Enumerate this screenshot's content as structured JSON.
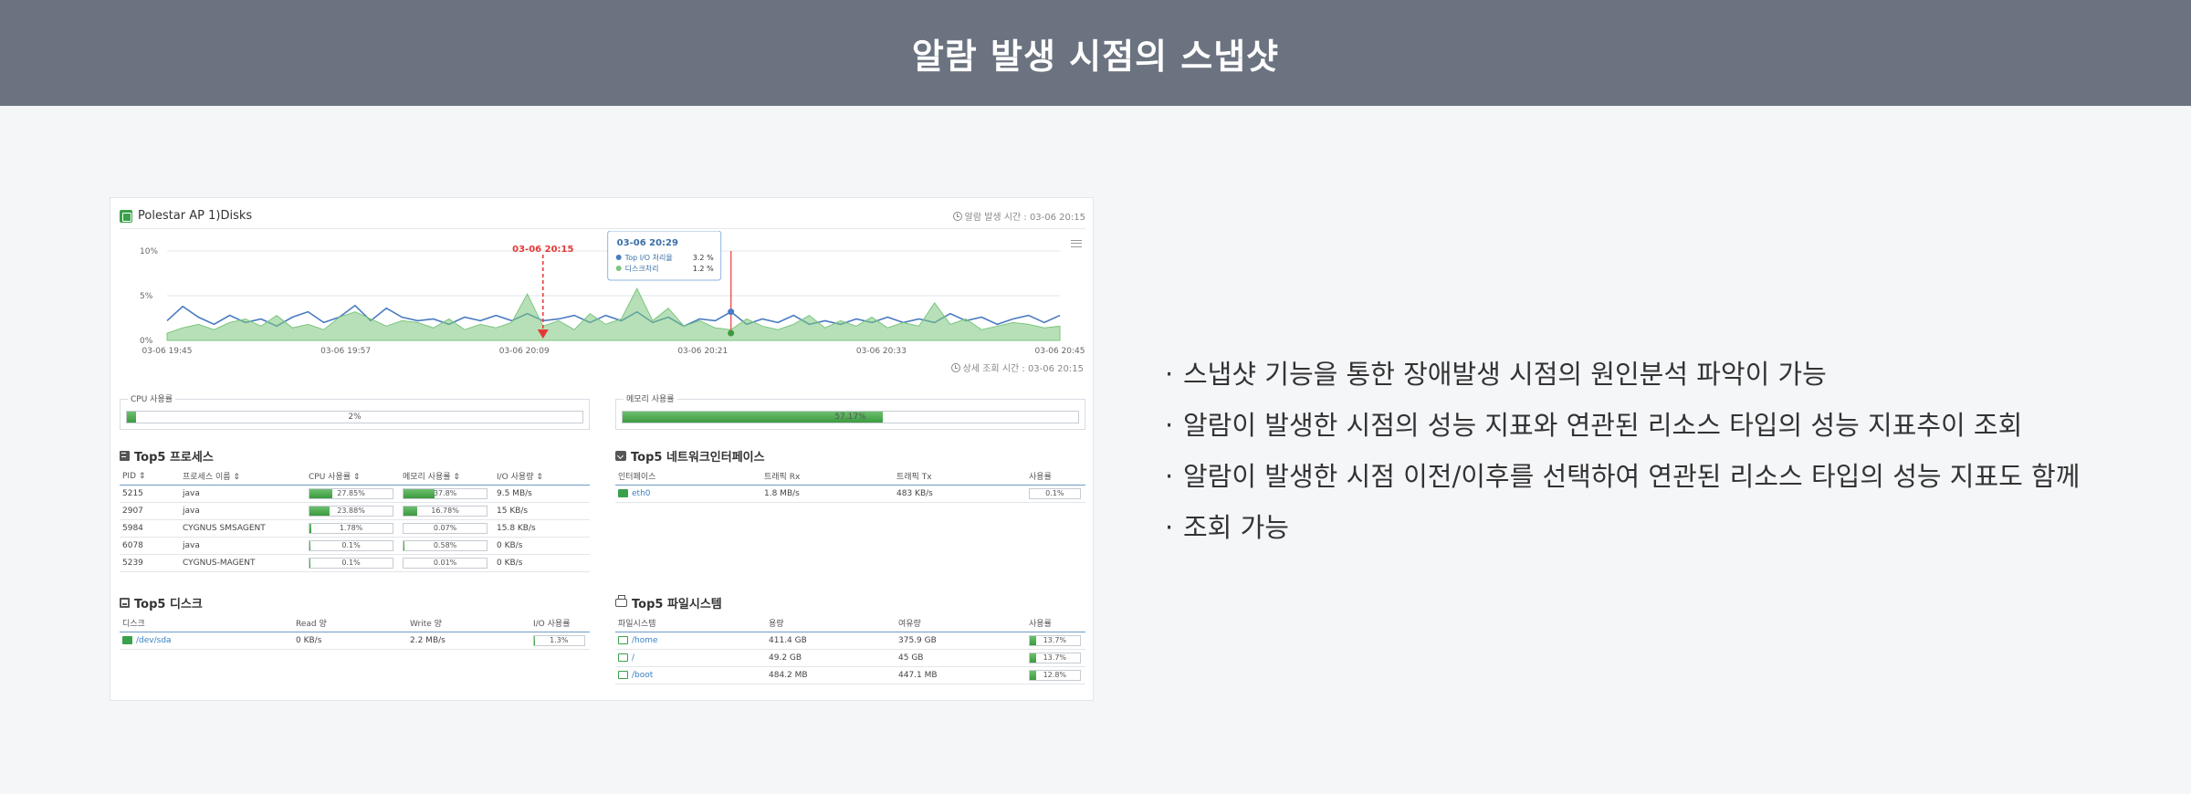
{
  "banner": {
    "title": "알람 발생 시점의 스냅샷"
  },
  "snapshot": {
    "title": "Polestar AP 1)Disks",
    "alarm_time_label": "알람 발생 시간 : 03-06 20:15",
    "query_time_label": "상세 조회 시간 : 03-06 20:15",
    "cpu_panel": {
      "label": "CPU 사용률",
      "value_label": "2%",
      "percent": 2
    },
    "mem_panel": {
      "label": "메모리 사용률",
      "value_label": "57.17%",
      "percent": 57.17
    },
    "top5_process": {
      "title": "Top5 프로세스",
      "columns": [
        "PID ⇕",
        "프로세스 이름 ⇕",
        "CPU 사용률 ⇕",
        "메모리 사용률 ⇕",
        "I/O 사용량 ⇕"
      ],
      "rows": [
        {
          "pid": "5215",
          "name": "java",
          "cpu": "27.85%",
          "cpu_pct": 27.85,
          "mem": "37.8%",
          "mem_pct": 37.8,
          "io": "9.5 MB/s"
        },
        {
          "pid": "2907",
          "name": "java",
          "cpu": "23.88%",
          "cpu_pct": 23.88,
          "mem": "16.78%",
          "mem_pct": 16.78,
          "io": "15 KB/s"
        },
        {
          "pid": "5984",
          "name": "CYGNUS SMSAGENT",
          "cpu": "1.78%",
          "cpu_pct": 1.78,
          "mem": "0.07%",
          "mem_pct": 0.07,
          "io": "15.8 KB/s"
        },
        {
          "pid": "6078",
          "name": "java",
          "cpu": "0.1%",
          "cpu_pct": 0.1,
          "mem": "0.58%",
          "mem_pct": 0.58,
          "io": "0 KB/s"
        },
        {
          "pid": "5239",
          "name": "CYGNUS-MAGENT",
          "cpu": "0.1%",
          "cpu_pct": 0.1,
          "mem": "0.01%",
          "mem_pct": 0.01,
          "io": "0 KB/s"
        }
      ]
    },
    "top5_network": {
      "title": "Top5 네트워크인터페이스",
      "columns": [
        "인터페이스",
        "트래픽 Rx",
        "트래픽 Tx",
        "사용률"
      ],
      "rows": [
        {
          "name": "eth0",
          "rx": "1.8 MB/s",
          "tx": "483 KB/s",
          "usage": "0.1%",
          "usage_pct": 0.1
        }
      ]
    },
    "top5_disk": {
      "title": "Top5 디스크",
      "columns": [
        "디스크",
        "Read 양",
        "Write 양",
        "I/O 사용률"
      ],
      "rows": [
        {
          "name": "/dev/sda",
          "read": "0 KB/s",
          "write": "2.2 MB/s",
          "usage": "1.3%",
          "usage_pct": 1.3
        }
      ]
    },
    "top5_fs": {
      "title": "Top5 파일시스템",
      "columns": [
        "파일시스템",
        "용량",
        "여유량",
        "사용률"
      ],
      "rows": [
        {
          "name": "/home",
          "size": "411.4 GB",
          "free": "375.9 GB",
          "usage": "13.7%",
          "usage_pct": 13.7
        },
        {
          "name": "/",
          "size": "49.2 GB",
          "free": "45 GB",
          "usage": "13.7%",
          "usage_pct": 13.7
        },
        {
          "name": "/boot",
          "size": "484.2 MB",
          "free": "447.1 MB",
          "usage": "12.8%",
          "usage_pct": 12.8
        }
      ]
    }
  },
  "chart_data": {
    "type": "line",
    "title": "",
    "xlabel": "",
    "ylabel": "",
    "y_ticks": [
      "0%",
      "5%",
      "10%"
    ],
    "ylim": [
      0,
      10
    ],
    "x_tick_labels": [
      "03-06 19:45",
      "03-06 19:57",
      "03-06 20:09",
      "03-06 20:21",
      "03-06 20:33",
      "03-06 20:45"
    ],
    "alarm_marker": {
      "label": "03-06 20:15",
      "index": 24
    },
    "tooltip": {
      "time": "03-06 20:29",
      "rows": [
        {
          "name": "Top I/O 처리율",
          "value": "3.2 %"
        },
        {
          "name": "디스크처리",
          "value": "1.2 %"
        }
      ],
      "index": 36
    },
    "series": [
      {
        "name": "Top I/O 처리율",
        "color": "#4a7bc0",
        "style": "line",
        "values": [
          2.2,
          3.8,
          2.6,
          1.8,
          2.8,
          2.0,
          2.4,
          1.6,
          2.6,
          3.2,
          2.0,
          2.6,
          3.9,
          2.2,
          3.6,
          2.6,
          2.2,
          2.4,
          1.8,
          2.6,
          2.2,
          2.8,
          2.2,
          3.0,
          2.2,
          2.4,
          2.8,
          2.0,
          2.8,
          2.2,
          3.2,
          2.0,
          2.6,
          1.6,
          2.4,
          2.2,
          3.2,
          1.8,
          2.4,
          2.0,
          2.8,
          1.8,
          2.2,
          1.8,
          2.4,
          2.0,
          2.6,
          2.0,
          2.4,
          2.0,
          3.0,
          2.2,
          2.6,
          1.8,
          2.4,
          2.8,
          2.0,
          2.8
        ]
      },
      {
        "name": "디스크처리",
        "color": "#7cc67e",
        "style": "area",
        "values": [
          0.8,
          1.4,
          1.8,
          1.2,
          2.0,
          2.4,
          1.6,
          2.8,
          1.4,
          1.8,
          1.2,
          2.6,
          3.2,
          2.4,
          1.6,
          2.2,
          2.0,
          1.4,
          2.4,
          1.2,
          1.8,
          1.4,
          2.0,
          5.2,
          1.6,
          2.2,
          1.2,
          3.0,
          1.8,
          2.4,
          5.8,
          2.2,
          3.6,
          1.6,
          2.2,
          1.4,
          1.2,
          2.4,
          1.6,
          1.2,
          1.8,
          2.8,
          1.4,
          2.2,
          1.6,
          2.6,
          1.4,
          2.0,
          1.6,
          4.2,
          1.8,
          2.4,
          1.2,
          1.6,
          2.0,
          1.8,
          1.4,
          1.6
        ]
      }
    ]
  },
  "bullets": [
    "스냅샷 기능을 통한 장애발생 시점의 원인분석 파악이 가능",
    "알람이 발생한 시점의 성능 지표와 연관된 리소스 타입의 성능 지표추이 조회",
    "알람이 발생한 시점 이전/이후를 선택하여 연관된 리소스 타입의 성능 지표도 함께",
    "조회 가능"
  ]
}
